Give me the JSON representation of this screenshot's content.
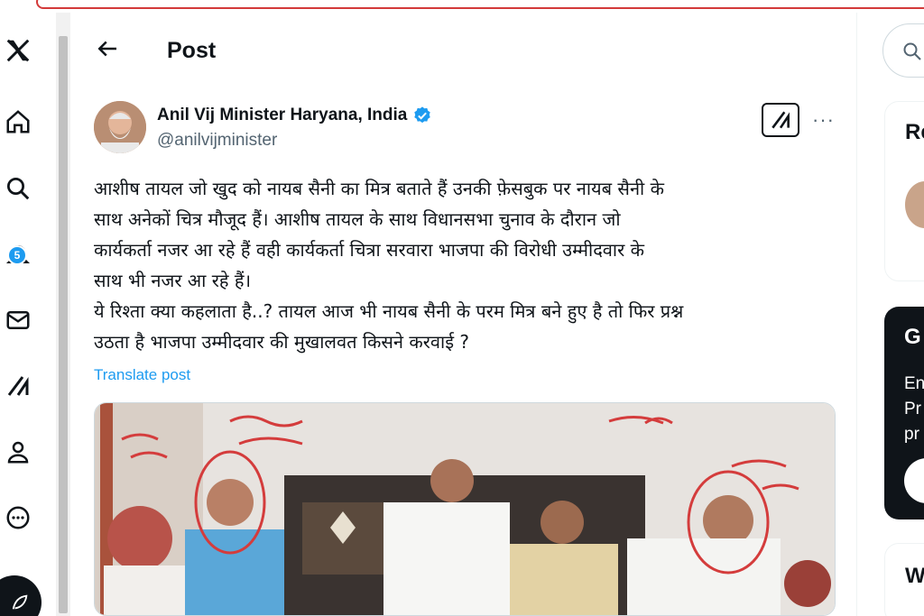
{
  "header": {
    "title": "Post"
  },
  "nav": {
    "notification_count": "5"
  },
  "tweet": {
    "author_name": "Anil Vij Minister Haryana, India",
    "handle": "@anilvijminister",
    "more_label": "···",
    "lines": [
      "आशीष तायल जो खुद को नायब सैनी का मित्र बताते हैं उनकी फ़ेसबुक पर नायब सैनी के",
      "साथ अनेकों चित्र मौजूद हैं। आशीष तायल के साथ विधानसभा चुनाव के दौरान जो",
      "कार्यकर्ता नजर आ रहे हैं वही कार्यकर्ता चित्रा सरवारा भाजपा की विरोधी उम्मीदवार के",
      "साथ भी नजर आ रहे हैं।",
      "ये रिश्ता क्या कहलाता है..? तायल आज भी नायब सैनी के परम मित्र बने हुए है तो फिर प्रश्न",
      "उठता है भाजपा उम्मीदवार की मुखालवत किसने करवाई ?"
    ],
    "translate_label": "Translate post"
  },
  "right": {
    "card1_title": "Re",
    "card2_title": "G",
    "card2_lines": [
      "En",
      "Pr",
      "pr"
    ],
    "card3_title": "W"
  }
}
